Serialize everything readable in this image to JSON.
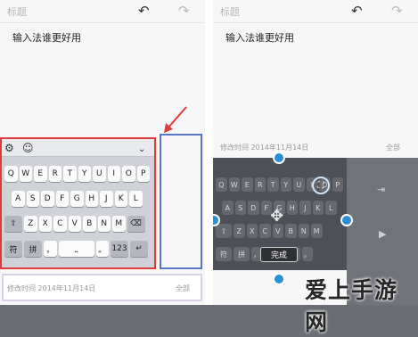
{
  "left": {
    "title_placeholder": "标题",
    "content": "输入法谁更好用",
    "toolbar_label": "☺",
    "date_text": "修改时间 2014年11月14日",
    "all_label": "全部",
    "rows": [
      [
        "Q",
        "W",
        "E",
        "R",
        "T",
        "Y",
        "U",
        "I",
        "O",
        "P"
      ],
      [
        "A",
        "S",
        "D",
        "F",
        "G",
        "H",
        "J",
        "K",
        "L"
      ],
      [
        "⇧",
        "Z",
        "X",
        "C",
        "V",
        "B",
        "N",
        "M",
        "⌫"
      ],
      [
        "符",
        "拼",
        "，",
        "⎵",
        "。",
        "123",
        "↵"
      ]
    ]
  },
  "right": {
    "title_placeholder": "标题",
    "content": "输入法谁更好用",
    "date_text": "修改时间 2014年11月14日",
    "all_label": "全部",
    "done_label": "完成",
    "rows": [
      [
        "Q",
        "W",
        "E",
        "R",
        "T",
        "Y",
        "U",
        "I",
        "O",
        "P"
      ],
      [
        "A",
        "S",
        "D",
        "F",
        "G",
        "H",
        "J",
        "K",
        "L"
      ],
      [
        "⇧",
        "Z",
        "X",
        "C",
        "V",
        "B",
        "N",
        "M"
      ],
      [
        "符",
        "拼",
        "，",
        "⎵",
        "。"
      ]
    ]
  },
  "watermark": "爱上手游网",
  "colors": {
    "red_outline": "#e03a3a",
    "blue_outline": "#5a74c8",
    "handle": "#2b8fd6"
  }
}
